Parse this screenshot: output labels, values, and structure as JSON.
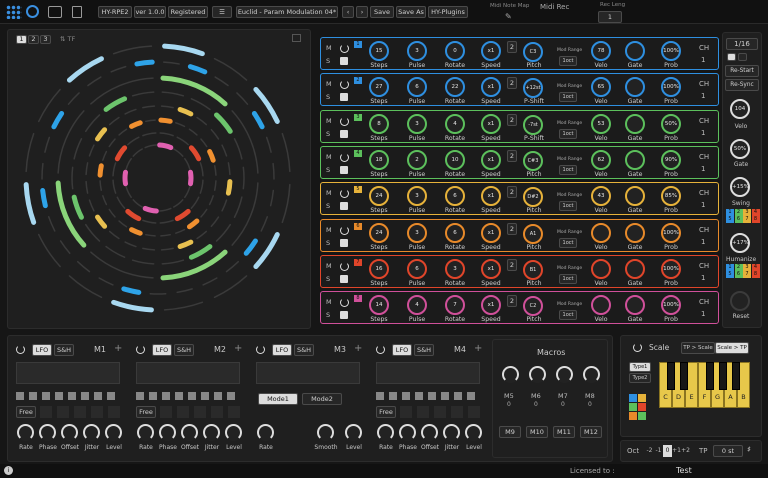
{
  "header": {
    "plugin_name": "HY-RPE2",
    "version": "ver 1.0.0",
    "registered": "Registered",
    "preset_name": "Euclid - Param Modulation 04*",
    "save": "Save",
    "save_as": "Save As",
    "plugins": "HY-Plugins",
    "midi_note_map": "Midi Note Map",
    "midi_rec": "Midi Rec",
    "rec_len_label": "Rec Leng",
    "rec_len_value": "1"
  },
  "circle_panel": {
    "page_tabs": [
      "1",
      "2",
      "3"
    ],
    "tf_label": "TF",
    "ring_colors": [
      "#a8d8f0",
      "#2ea3e8",
      "#8ad47a",
      "#e8e070",
      "#f0a040",
      "#f06020",
      "#e060b0",
      "#c8c8c8"
    ]
  },
  "tracks": [
    {
      "color": "#2e8fe0",
      "num": "1",
      "steps": "15",
      "pulse": "3",
      "rotate": "0",
      "speed": "x1",
      "speed_val": "2",
      "pitch": "C3",
      "pitch_mode": "D#  F#",
      "velo": "78",
      "gate": "",
      "prob": "100%",
      "mod_label": "Mod Range",
      "oct": "1oct",
      "mode": "Pitch",
      "m": "M",
      "s": "S"
    },
    {
      "color": "#2e8fe0",
      "num": "2",
      "steps": "27",
      "pulse": "6",
      "rotate": "22",
      "speed": "x1",
      "speed_val": "2",
      "pitch": "+12st",
      "pitch_mode": "",
      "velo": "65",
      "gate": "",
      "prob": "100%",
      "mod_label": "Mod Range",
      "oct": "1oct",
      "mode": "P-Shift",
      "m": "M",
      "s": "S"
    },
    {
      "color": "#5cc05c",
      "num": "3",
      "steps": "8",
      "pulse": "3",
      "rotate": "4",
      "speed": "x1",
      "speed_val": "2",
      "pitch": "-7st",
      "pitch_mode": "",
      "velo": "53",
      "gate": "",
      "prob": "50%",
      "mod_label": "Mod Range",
      "oct": "1oct",
      "mode": "P-Shift",
      "m": "M",
      "s": "S"
    },
    {
      "color": "#5cc05c",
      "num": "4",
      "steps": "18",
      "pulse": "2",
      "rotate": "10",
      "speed": "x1",
      "speed_val": "2",
      "pitch": "C#3",
      "pitch_mode": "",
      "velo": "62",
      "gate": "",
      "prob": "90%",
      "mod_label": "Mod Range",
      "oct": "1oct",
      "mode": "Pitch",
      "m": "M",
      "s": "S"
    },
    {
      "color": "#e6b23a",
      "num": "5",
      "steps": "24",
      "pulse": "3",
      "rotate": "6",
      "speed": "x1",
      "speed_val": "2",
      "pitch": "D#2",
      "pitch_mode": "",
      "velo": "43",
      "gate": "",
      "prob": "85%",
      "mod_label": "Mod Range",
      "oct": "1oct",
      "mode": "Pitch",
      "m": "M",
      "s": "S"
    },
    {
      "color": "#e88a2a",
      "num": "6",
      "steps": "24",
      "pulse": "3",
      "rotate": "6",
      "speed": "x1",
      "speed_val": "2",
      "pitch": "A1",
      "pitch_mode": "",
      "velo": "",
      "gate": "",
      "prob": "100%",
      "mod_label": "Mod Range",
      "oct": "1oct",
      "mode": "Pitch",
      "m": "M",
      "s": "S"
    },
    {
      "color": "#e0452a",
      "num": "7",
      "steps": "16",
      "pulse": "6",
      "rotate": "3",
      "speed": "x1",
      "speed_val": "2",
      "pitch": "B1",
      "pitch_mode": "",
      "velo": "",
      "gate": "",
      "prob": "100%",
      "mod_label": "Mod Range",
      "oct": "1oct",
      "mode": "Pitch",
      "m": "M",
      "s": "S"
    },
    {
      "color": "#d0509a",
      "num": "8",
      "steps": "14",
      "pulse": "4",
      "rotate": "7",
      "speed": "x1",
      "speed_val": "2",
      "pitch": "C2",
      "pitch_mode": "",
      "velo": "",
      "gate": "",
      "prob": "100%",
      "mod_label": "Mod Range",
      "oct": "1oct",
      "mode": "Pitch",
      "m": "M",
      "s": "S"
    }
  ],
  "track_labels": {
    "steps": "Steps",
    "pulse": "Pulse",
    "rotate": "Rotate",
    "speed": "Speed",
    "velo": "Velo",
    "gate": "Gate",
    "prob": "Prob",
    "ch": "CH",
    "ch_val": "1"
  },
  "right_panel": {
    "rate": "1/16",
    "restart": "Re-Start",
    "resync": "Re-Sync",
    "velo_val": "104",
    "velo": "Velo",
    "gate_val": "50%",
    "gate": "Gate",
    "swing_val": "+15%",
    "swing": "Swing",
    "swing_grid": [
      "1",
      "2",
      "3",
      "4",
      "5",
      "6",
      "7",
      "8"
    ],
    "humanize_val": "+17%",
    "humanize": "Humanize",
    "humanize_grid": [
      "1",
      "2",
      "3",
      "4",
      "5",
      "6",
      "7",
      "8"
    ],
    "reset": "Reset"
  },
  "modulators": [
    {
      "name": "M1",
      "lfo": "LFO",
      "sh": "S&H",
      "mode": "Free",
      "knobs": [
        "Rate",
        "Phase",
        "Offset",
        "Jitter",
        "Level"
      ]
    },
    {
      "name": "M2",
      "lfo": "LFO",
      "sh": "S&H",
      "mode": "Free",
      "knobs": [
        "Rate",
        "Phase",
        "Offset",
        "Jitter",
        "Level"
      ]
    },
    {
      "name": "M3",
      "lfo": "LFO",
      "sh": "S&H",
      "mode1": "Mode1",
      "mode2": "Mode2",
      "knobs": [
        "Rate",
        "Smooth",
        "Level"
      ]
    },
    {
      "name": "M4",
      "lfo": "LFO",
      "sh": "S&H",
      "mode": "Free",
      "knobs": [
        "Rate",
        "Phase",
        "Offset",
        "Jitter",
        "Level"
      ]
    }
  ],
  "macros": {
    "title": "Macros",
    "labels": [
      "M5",
      "M6",
      "M7",
      "M8"
    ],
    "values": [
      "0",
      "0",
      "0",
      "0"
    ],
    "buttons": [
      "M9",
      "M10",
      "M11",
      "M12"
    ]
  },
  "scale": {
    "title": "Scale",
    "tp_scale": "TP > Scale",
    "scale_tp": "Scale > TP",
    "type1": "Type1",
    "type2": "Type2",
    "keys": [
      "C",
      "D",
      "E",
      "F",
      "G",
      "A",
      "B"
    ],
    "black_keys": [
      "C#",
      "D#"
    ],
    "oct_label": "Oct",
    "oct_values": [
      "-2",
      "-1",
      "0",
      "+1",
      "+2"
    ],
    "tp_label": "TP",
    "tp_value": "0 st"
  },
  "footer": {
    "licensed": "Licensed to :",
    "user": "Test"
  }
}
